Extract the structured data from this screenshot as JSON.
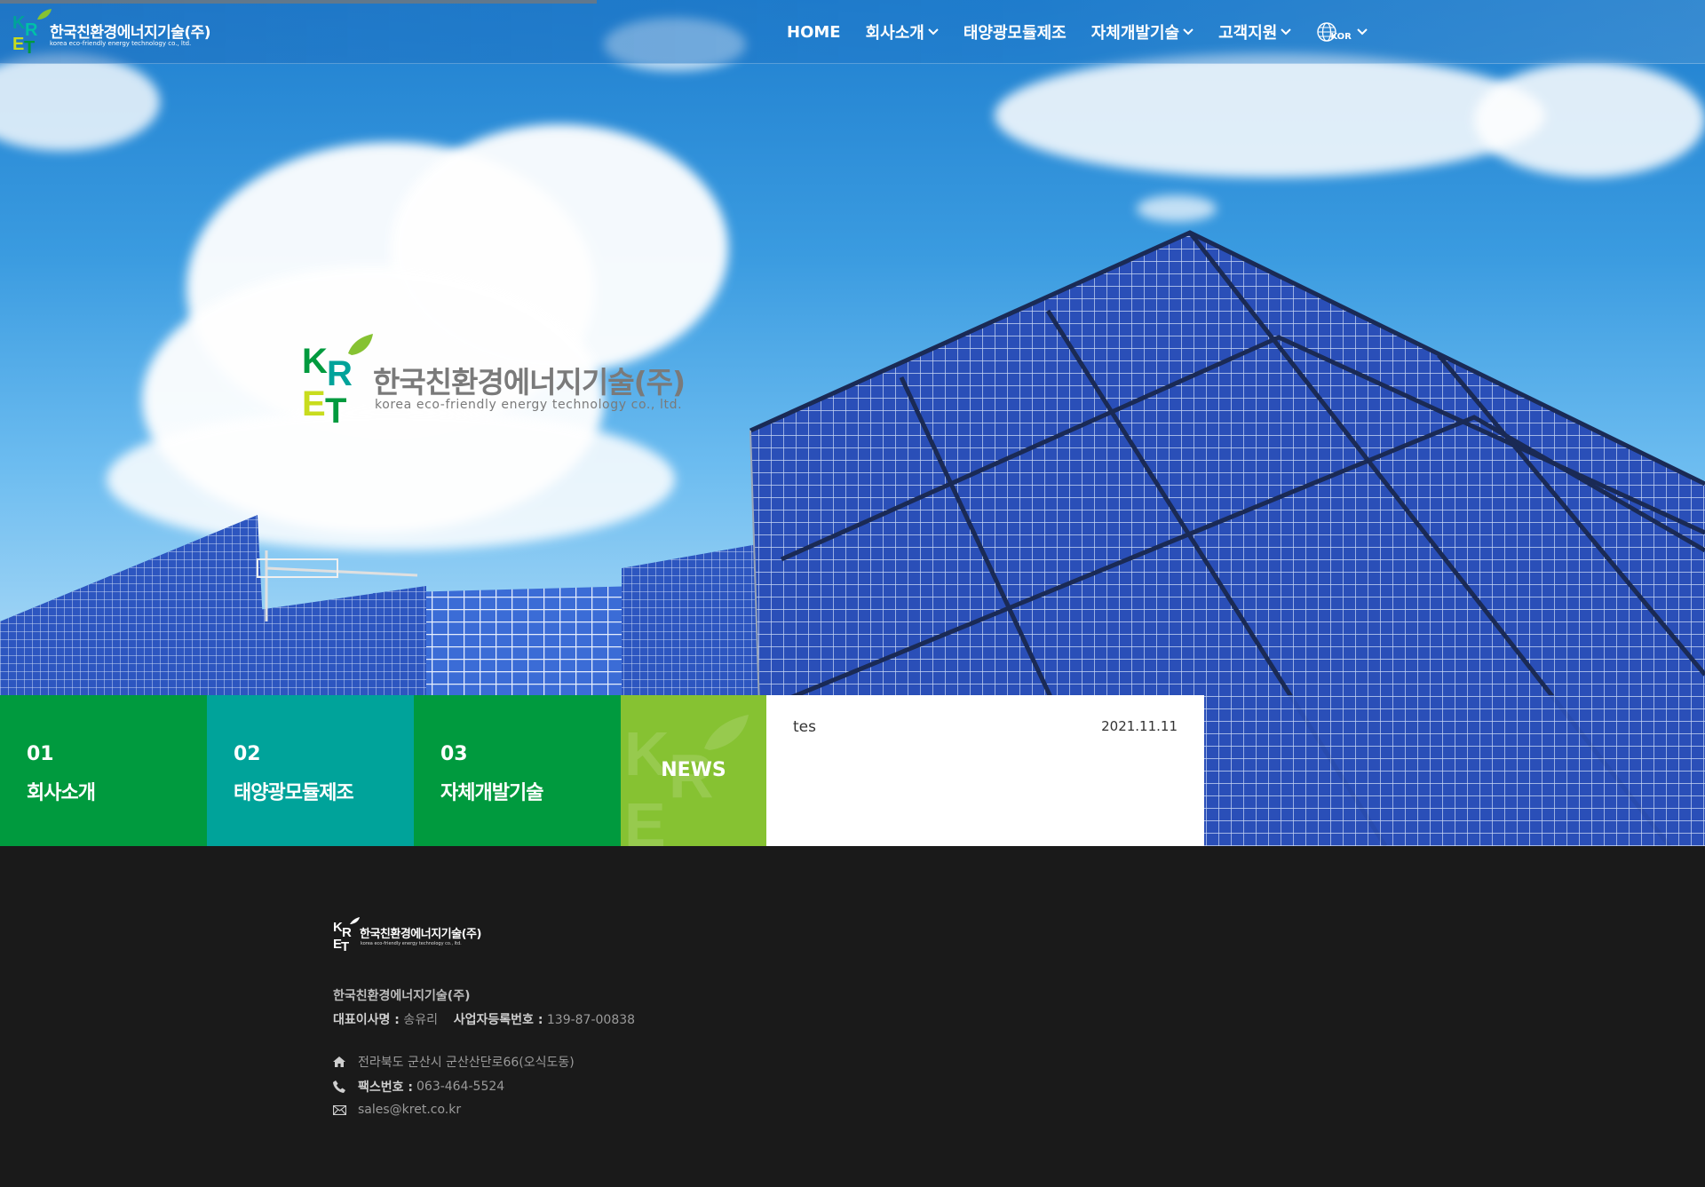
{
  "brand": {
    "name_ko": "한국친환경에너지기술(주)",
    "name_en": "korea eco-friendly energy technology co., ltd.",
    "logo_letters": "KRET",
    "colors": {
      "green": "#009a3e",
      "teal": "#00a39a",
      "lime": "#86c232",
      "yellow": "#c8dc1e"
    }
  },
  "nav": {
    "items": [
      {
        "label": "HOME",
        "has_dropdown": false
      },
      {
        "label": "회사소개",
        "has_dropdown": true
      },
      {
        "label": "태양광모듈제조",
        "has_dropdown": false
      },
      {
        "label": "자체개발기술",
        "has_dropdown": true
      },
      {
        "label": "고객지원",
        "has_dropdown": true
      }
    ],
    "language": {
      "icon": "globe-icon",
      "label": "KOR"
    }
  },
  "tiles": [
    {
      "num": "01",
      "label": "회사소개"
    },
    {
      "num": "02",
      "label": "태양광모듈제조"
    },
    {
      "num": "03",
      "label": "자체개발기술"
    }
  ],
  "news": {
    "label": "NEWS",
    "items": [
      {
        "title": "tes",
        "date": "2021.11.11"
      }
    ]
  },
  "footer": {
    "company": "한국친환경에너지기술(주)",
    "ceo_label": "대표이사명 :",
    "ceo": "송유리",
    "reg_label": "사업자등록번호 :",
    "reg": "139-87-00838",
    "address": "전라북도 군산시 군산산단로66(오식도동)",
    "fax_label": "팩스번호 :",
    "fax": "063-464-5524",
    "email": "sales@kret.co.kr",
    "icons": [
      "home-icon",
      "phone-icon",
      "mail-icon"
    ]
  }
}
